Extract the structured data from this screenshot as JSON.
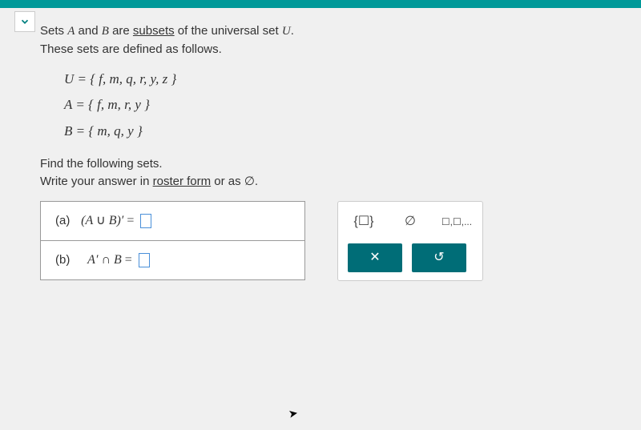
{
  "intro": {
    "line1_prefix": "Sets ",
    "varA": "A",
    "and": " and ",
    "varB": "B",
    "line1_mid": " are ",
    "subsets_link": "subsets",
    "line1_suffix": " of the universal set ",
    "varU": "U",
    "period": ".",
    "line2": "These sets are defined as follows."
  },
  "sets": {
    "U": "U = { f, m, q, r, y, z }",
    "A": "A = { f, m, r, y }",
    "B": "B = { m, q, y }"
  },
  "instruction": {
    "line1": "Find the following sets.",
    "line2_prefix": "Write your answer in ",
    "roster_link": "roster form",
    "line2_mid": " or as ",
    "empty_symbol": "∅",
    "line2_suffix": "."
  },
  "parts": {
    "a": {
      "label": "(a)",
      "expr_prefix": "(A ",
      "union": "∪",
      "expr_mid": " B)′",
      "equals": " = "
    },
    "b": {
      "label": "(b)",
      "expr_prefix": "A′ ",
      "intersect": "∩",
      "expr_mid": " B",
      "equals": " = "
    }
  },
  "palette": {
    "braces": "{☐}",
    "empty": "∅",
    "list": "☐,☐,...",
    "clear": "✕",
    "reset": "↺"
  }
}
